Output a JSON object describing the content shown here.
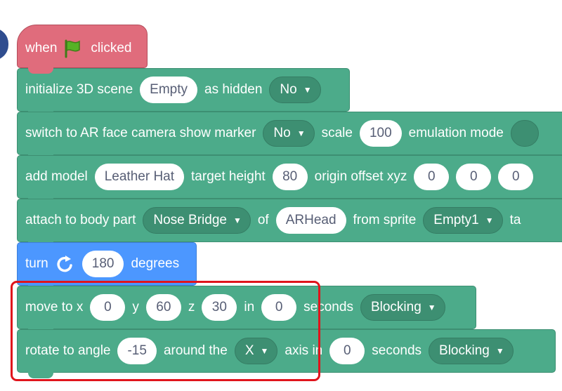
{
  "hat": {
    "when": "when",
    "clicked": "clicked"
  },
  "init_scene": {
    "label": "initialize 3D scene",
    "scene_value": "Empty",
    "hidden_label": "as hidden",
    "hidden_value": "No"
  },
  "switch_ar": {
    "label": "switch to AR face camera show marker",
    "marker_value": "No",
    "scale_label": "scale",
    "scale_value": "100",
    "emulation_label": "emulation mode"
  },
  "add_model": {
    "label": "add model",
    "model_value": "Leather Hat",
    "height_label": "target height",
    "height_value": "80",
    "offset_label": "origin offset xyz",
    "x": "0",
    "y": "0",
    "z": "0"
  },
  "attach": {
    "label": "attach to body part",
    "part_value": "Nose Bridge",
    "of_label": "of",
    "of_value": "ARHead",
    "sprite_label": "from sprite",
    "sprite_value": "Empty1",
    "tail_label": "ta"
  },
  "turn": {
    "label": "turn",
    "value": "180",
    "unit": "degrees"
  },
  "move": {
    "label": "move to x",
    "x": "0",
    "y_label": "y",
    "y": "60",
    "z_label": "z",
    "z": "30",
    "in_label": "in",
    "time": "0",
    "seconds_label": "seconds",
    "mode": "Blocking"
  },
  "rotate": {
    "label": "rotate to angle",
    "angle": "-15",
    "around_label": "around the",
    "axis": "X",
    "axis_label": "axis in",
    "time": "0",
    "seconds_label": "seconds",
    "mode": "Blocking"
  },
  "colors": {
    "green_block": "#4cab8a",
    "blue_block": "#4c97ff",
    "hat_block": "#e06c7c",
    "highlight": "#e0141c"
  },
  "icons": [
    "green-flag-icon",
    "rotate-clockwise-icon",
    "dropdown-caret-icon"
  ]
}
